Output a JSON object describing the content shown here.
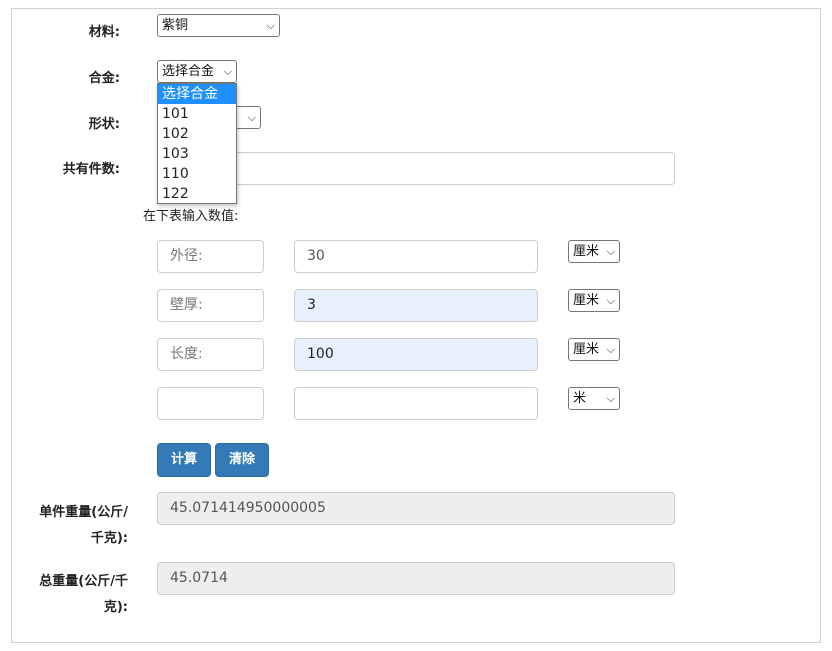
{
  "material": {
    "label": "材料:",
    "value": "紫铜"
  },
  "alloy": {
    "label": "合金:",
    "value": "选择合金",
    "options": [
      "选择合金",
      "101",
      "102",
      "103",
      "110",
      "122"
    ]
  },
  "shape": {
    "label": "形状:"
  },
  "count": {
    "label": "共有件数:"
  },
  "hint": "在下表输入数值:",
  "rows": [
    {
      "name": "外径:",
      "value": "30",
      "unit": "厘米"
    },
    {
      "name": "壁厚:",
      "value": "3",
      "unit": "厘米"
    },
    {
      "name": "长度:",
      "value": "100",
      "unit": "厘米"
    },
    {
      "name": "",
      "value": "",
      "unit": "米"
    }
  ],
  "buttons": {
    "calculate": "计算",
    "clear": "清除"
  },
  "unit_weight": {
    "label_line1": "单件重量(公斤/",
    "label_line2": "千克):",
    "value": "45.071414950000005"
  },
  "total_weight": {
    "label_line1": "总重量(公斤/千",
    "label_line2": "克):",
    "value": "45.0714"
  },
  "icons": {
    "dropdown_arrow": "chevron-down-icon"
  }
}
